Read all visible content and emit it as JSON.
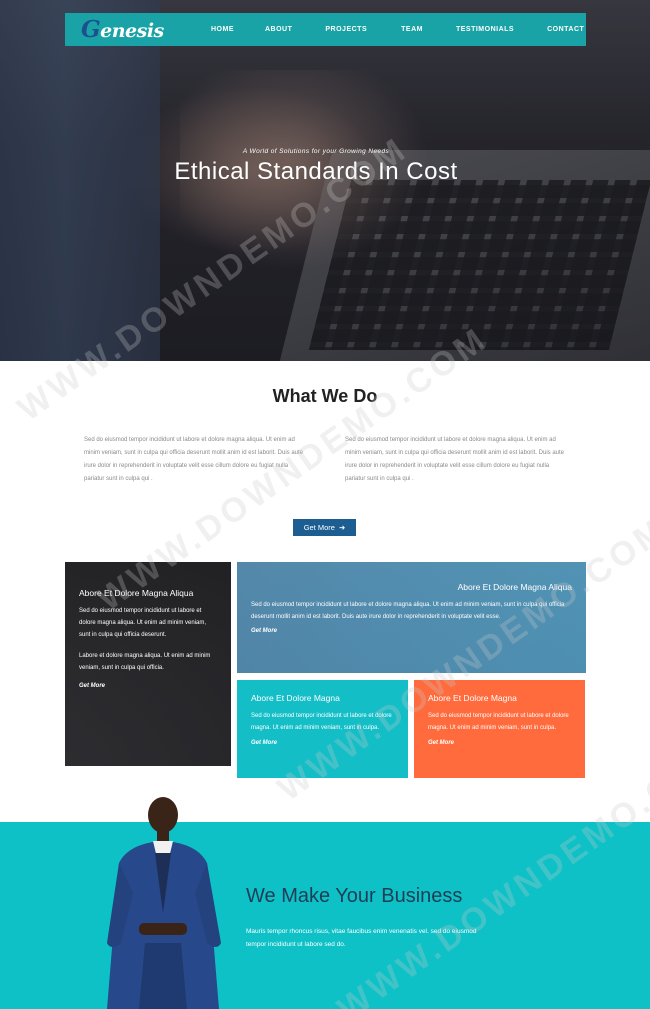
{
  "nav": {
    "logo_initial": "G",
    "logo_rest": "enesis",
    "items": [
      "HOME",
      "ABOUT",
      "PROJECTS",
      "TEAM",
      "TESTIMONIALS",
      "CONTACT"
    ]
  },
  "hero": {
    "tagline": "A World of Solutions for your Growing Needs",
    "title": "Ethical Standards In Cost"
  },
  "what_we_do": {
    "title": "What We Do",
    "col1": "Sed do eiusmod tempor incididunt ut labore et dolore magna aliqua. Ut enim ad minim veniam, sunt in culpa qui officia deserunt mollit anim id est laborit. Duis aute irure dolor in reprehenderit in voluptate velit esse cillum dolore eu fugiat nulla pariatur sunt in culpa qui .",
    "col2": "Sed do eiusmod tempor incididunt ut labore et dolore magna aliqua. Ut enim ad minim veniam, sunt in culpa qui officia deserunt mollit anim id est laborit. Duis aute irure dolor in reprehenderit in voluptate velit esse cillum dolore eu fugiat nulla pariatur sunt in culpa qui .",
    "button": "Get More",
    "button_arrow": "➜"
  },
  "services": {
    "card1": {
      "title": "Abore Et Dolore Magna Aliqua",
      "text1": "Sed do eiusmod tempor incididunt ut labore et dolore magna aliqua. Ut enim ad minim veniam, sunt in culpa qui officia deserunt.",
      "text2": "Labore et dolore magna aliqua. Ut enim ad minim veniam, sunt in culpa qui officia.",
      "link": "Get More"
    },
    "card2": {
      "title": "Abore Et Dolore Magna Aliqua",
      "text": "Sed do eiusmod tempor incididunt ut labore et dolore magna aliqua. Ut enim ad minim veniam, sunt in culpa qui officia deserunt mollit anim id est laborit. Duis aute irure dolor in reprehenderit in voluptate velit esse.",
      "link": "Get More"
    },
    "card3": {
      "title": "Abore Et Dolore Magna",
      "text": "Sed do eiusmod tempor incididunt ut labore et dolore magna. Ut enim ad minim veniam, sunt in culpa.",
      "link": "Get More"
    },
    "card4": {
      "title": "Abore Et Dolore Magna",
      "text": "Sed do eiusmod tempor incididunt ut labore et dolore magna. Ut enim ad minim veniam, sunt in culpa.",
      "link": "Get More"
    }
  },
  "band": {
    "title": "We Make Your Business",
    "text": "Mauris tempor rhoncus risus, vitae faucibus enim venenatis vel. sed do eiusmod tempor incididunt ut labore sed do."
  },
  "watermark": "WWW.DOWNDEMO.COM",
  "colors": {
    "nav_bg": "#1aa3a6",
    "button_bg": "#1c5e91",
    "teal": "#14bec7",
    "orange": "#ff6b3d",
    "band_bg": "#0ec1c7"
  }
}
